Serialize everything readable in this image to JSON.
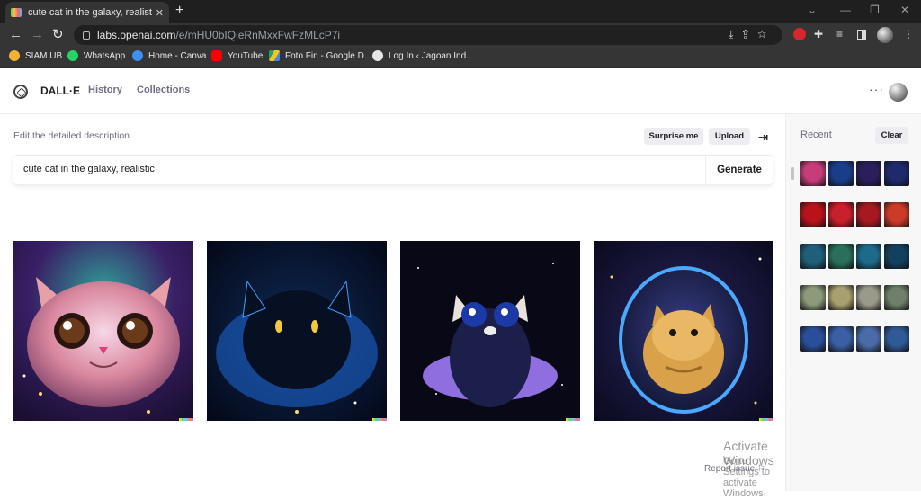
{
  "browser": {
    "tab_title": "cute cat in the galaxy, realistic | D",
    "url_domain": "labs.openai.com",
    "url_path": "/e/mHU0bIQieRnMxxFwFzMLcP7i",
    "bookmarks": [
      {
        "label": "SIAM UB",
        "icon": "siam-ub-icon",
        "color": "#f2b233"
      },
      {
        "label": "WhatsApp",
        "icon": "whatsapp-icon",
        "color": "#25d366"
      },
      {
        "label": "Home - Canva",
        "icon": "canva-icon",
        "color": "#3f8ef1"
      },
      {
        "label": "YouTube",
        "icon": "youtube-icon",
        "color": "#ff0000"
      },
      {
        "label": "Foto Fin - Google D...",
        "icon": "google-drive-icon",
        "color": "#f5c518"
      },
      {
        "label": "Log In ‹ Jagoan Ind...",
        "icon": "globe-icon",
        "color": "#e6e6e6"
      }
    ]
  },
  "app": {
    "brand": "DALL·E",
    "nav": [
      "History",
      "Collections"
    ]
  },
  "editor": {
    "description_label": "Edit the detailed description",
    "surprise_label": "Surprise me",
    "upload_label": "Upload",
    "prompt_value": "cute cat in the galaxy, realistic",
    "generate_label": "Generate"
  },
  "results": [
    {
      "name": "result-image-1",
      "subject": "pink-cat-face"
    },
    {
      "name": "result-image-2",
      "subject": "black-cat-blue-nebula"
    },
    {
      "name": "result-image-3",
      "subject": "dark-cat-purple-cloud"
    },
    {
      "name": "result-image-4",
      "subject": "tabby-cat-in-bubble"
    }
  ],
  "footer": {
    "report_label": "Report issue"
  },
  "watermark": {
    "line1": "Activate Windows",
    "line2": "Go to Settings to activate Windows."
  },
  "sidebar": {
    "recent_label": "Recent",
    "clear_label": "Clear",
    "groups": [
      {
        "name": "cats",
        "colors": [
          "#c63d7a",
          "#1a3d8a",
          "#2a1f5c",
          "#1e2a6b"
        ]
      },
      {
        "name": "horses",
        "colors": [
          "#b8121b",
          "#c9202b",
          "#a81820",
          "#cc3a28"
        ]
      },
      {
        "name": "underwater",
        "colors": [
          "#1f5f7a",
          "#2a6f5a",
          "#1d6a8a",
          "#13405c"
        ]
      },
      {
        "name": "animals",
        "colors": [
          "#8c9a7a",
          "#a9a070",
          "#9a9a8a",
          "#6f7f6a"
        ]
      },
      {
        "name": "astronauts",
        "colors": [
          "#2a4f9a",
          "#3a5fa5",
          "#4a6aa8",
          "#2f5a96"
        ]
      }
    ]
  }
}
